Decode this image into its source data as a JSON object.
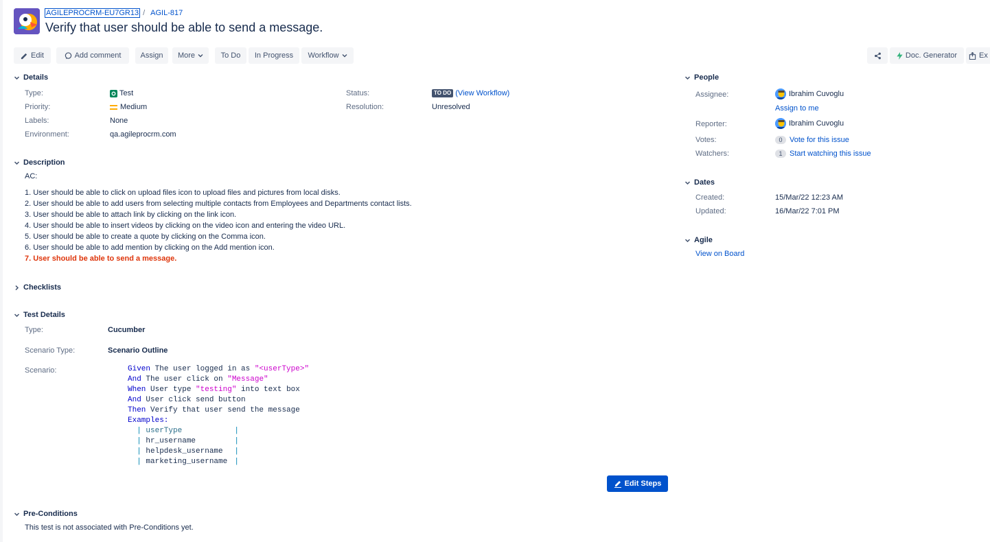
{
  "breadcrumb": {
    "project_key": "AGILEPROCRM-EU7GR13",
    "separator": "/",
    "issue_key": "AGIL-817"
  },
  "issue": {
    "title": "Verify that user should be able to send a message."
  },
  "toolbar": {
    "edit": "Edit",
    "add_comment": "Add comment",
    "assign": "Assign",
    "more": "More",
    "todo": "To Do",
    "in_progress": "In Progress",
    "workflow": "Workflow",
    "doc_generator": "Doc. Generator",
    "export": "Ex"
  },
  "details": {
    "heading": "Details",
    "type_label": "Type:",
    "type_value": "Test",
    "priority_label": "Priority:",
    "priority_value": "Medium",
    "labels_label": "Labels:",
    "labels_value": "None",
    "environment_label": "Environment:",
    "environment_value": "qa.agileprocrm.com",
    "status_label": "Status:",
    "status_badge": "TO DO",
    "status_link": "(View Workflow)",
    "resolution_label": "Resolution:",
    "resolution_value": "Unresolved"
  },
  "description": {
    "heading": "Description",
    "intro": "AC:",
    "items": [
      "1. User should be able to click on upload files icon to upload files and pictures from local disks.",
      "2. User should be able to add users from selecting multiple contacts from Employees and Departments contact lists.",
      "3. User should be able to attach link by clicking on the link icon.",
      "4. User should be able to insert videos by clicking on the video icon and entering the video URL.",
      "5. User should be able to create a quote by clicking on the Comma icon.",
      "6. User should be able to add mention by clicking on the Add mention icon."
    ],
    "highlight": "7. User should be able to send a message."
  },
  "checklists": {
    "heading": "Checklists"
  },
  "test_details": {
    "heading": "Test Details",
    "type_label": "Type:",
    "type_value": "Cucumber",
    "scenario_type_label": "Scenario Type:",
    "scenario_type_value": "Scenario Outline",
    "scenario_label": "Scenario:",
    "scenario": {
      "l1_kw": "Given",
      "l1_text": " The user logged in as ",
      "l1_str": "\"<userType>\"",
      "l2_kw": "And",
      "l2_text": " The user click on ",
      "l2_str": "\"Message\"",
      "l3_kw": "When",
      "l3_text1": " User type ",
      "l3_str": "\"testing\"",
      "l3_text2": " into text box",
      "l4_kw": "And",
      "l4_text": " User click send button",
      "l5_kw": "Then",
      "l5_text": " Verify that user send the message",
      "examples": "Examples:",
      "table": [
        "userType",
        "hr_username",
        "helpdesk_username",
        "marketing_username"
      ]
    },
    "edit_steps": "Edit Steps"
  },
  "preconditions": {
    "heading": "Pre-Conditions",
    "text": "This test is not associated with Pre-Conditions yet."
  },
  "people": {
    "heading": "People",
    "assignee_label": "Assignee:",
    "assignee_name": "Ibrahim Cuvoglu",
    "assign_to_me": "Assign to me",
    "reporter_label": "Reporter:",
    "reporter_name": "Ibrahim Cuvoglu",
    "votes_label": "Votes:",
    "votes_count": "0",
    "vote_link": "Vote for this issue",
    "watchers_label": "Watchers:",
    "watchers_count": "1",
    "watch_link": "Start watching this issue"
  },
  "dates": {
    "heading": "Dates",
    "created_label": "Created:",
    "created_value": "15/Mar/22 12:23 AM",
    "updated_label": "Updated:",
    "updated_value": "16/Mar/22 7:01 PM"
  },
  "agile": {
    "heading": "Agile",
    "board_link": "View on Board"
  },
  "colors": {
    "link": "#0052cc",
    "highlight_red": "#de350b",
    "button_primary": "#0052cc",
    "badge_grey": "#42526e"
  }
}
